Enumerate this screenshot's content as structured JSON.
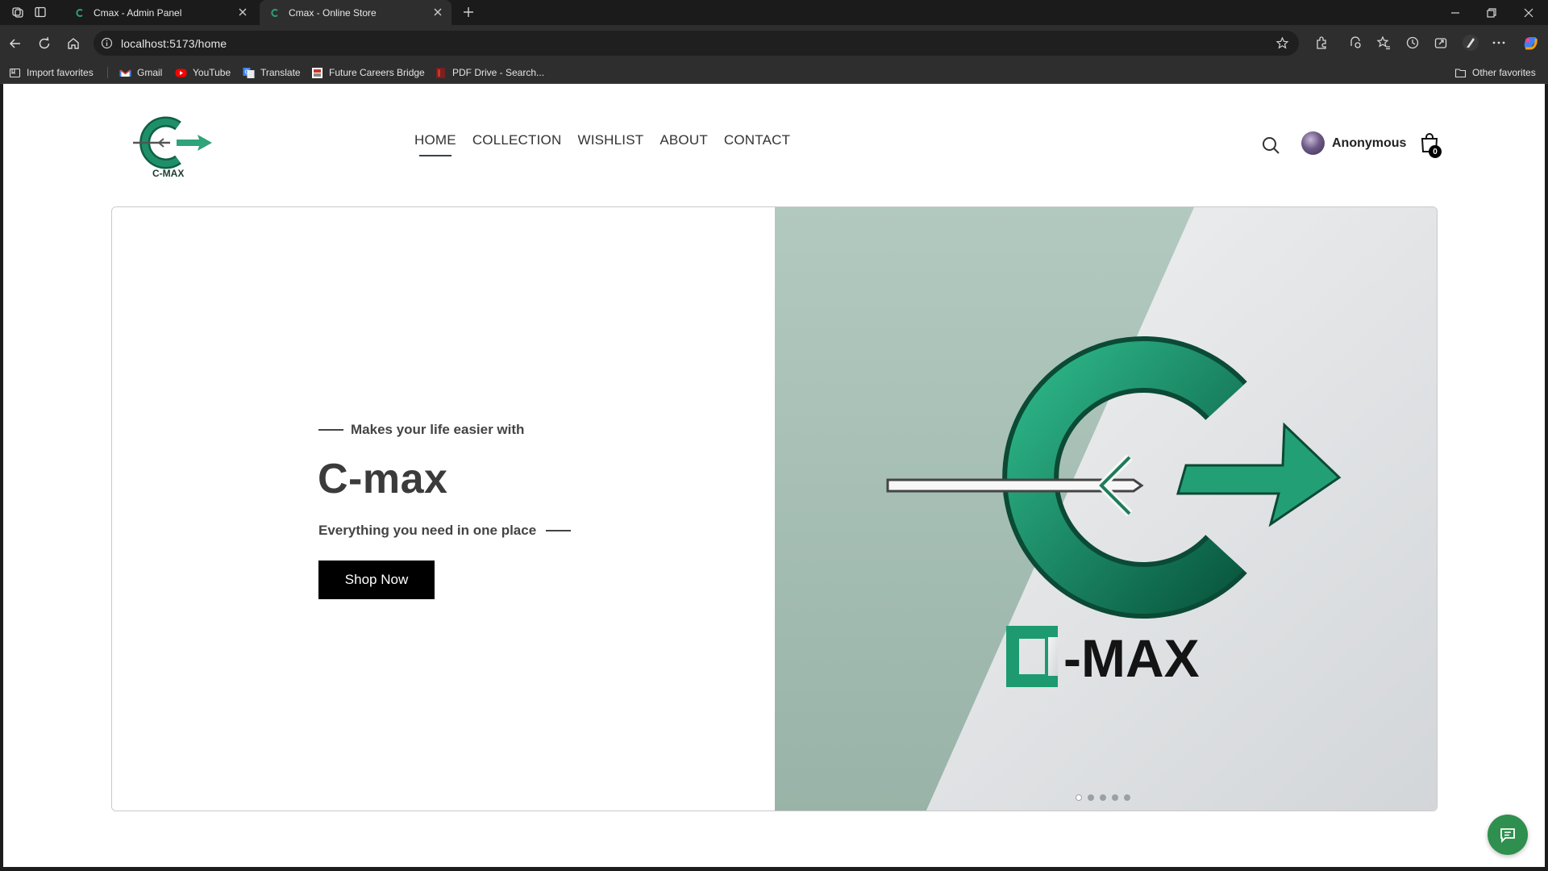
{
  "browser": {
    "tabs": [
      {
        "title": "Cmax - Admin Panel",
        "active": false
      },
      {
        "title": "Cmax - Online Store",
        "active": true
      }
    ],
    "url": "localhost:5173/home",
    "bookmarks": [
      {
        "label": "Import favorites",
        "icon": "import-icon"
      },
      {
        "label": "Gmail",
        "icon": "gmail-icon"
      },
      {
        "label": "YouTube",
        "icon": "youtube-icon"
      },
      {
        "label": "Translate",
        "icon": "translate-icon"
      },
      {
        "label": "Future Careers Bridge",
        "icon": "site-icon"
      },
      {
        "label": "PDF Drive - Search...",
        "icon": "pdf-icon"
      },
      {
        "label": "Other favorites",
        "icon": "folder-icon"
      }
    ]
  },
  "header": {
    "nav": [
      {
        "label": "HOME",
        "active": true
      },
      {
        "label": "COLLECTION",
        "active": false
      },
      {
        "label": "WISHLIST",
        "active": false
      },
      {
        "label": "ABOUT",
        "active": false
      },
      {
        "label": "CONTACT",
        "active": false
      }
    ],
    "user_name": "Anonymous",
    "cart_count": "0"
  },
  "hero": {
    "eyebrow": "Makes your life easier with",
    "title": "C-max",
    "subtitle": "Everything you need in one place",
    "cta": "Shop Now",
    "brand_text": "C-MAX",
    "slides_count": 5,
    "active_slide": 1
  },
  "colors": {
    "brand_green": "#1f8f6a",
    "dark_green": "#0f5f45",
    "chat_green": "#2f8f4e"
  }
}
